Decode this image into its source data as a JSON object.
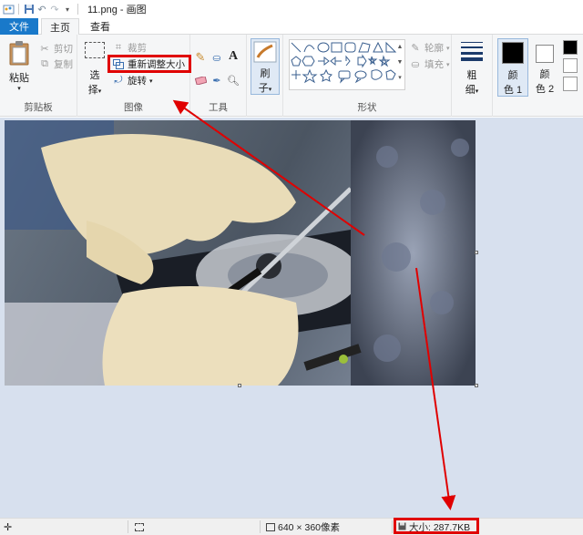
{
  "window": {
    "title": "11.png - 画图"
  },
  "tabs": {
    "file": "文件",
    "home": "主页",
    "view": "查看"
  },
  "clipboard": {
    "paste": "粘贴",
    "cut": "剪切",
    "copy": "复制",
    "group": "剪贴板"
  },
  "image": {
    "select_1": "选",
    "select_2": "择",
    "crop": "裁剪",
    "resize": "重新调整大小",
    "rotate": "旋转",
    "group": "图像"
  },
  "tools": {
    "group": "工具"
  },
  "brushes": {
    "label_1": "刷",
    "label_2": "子"
  },
  "shapes": {
    "outline": "轮廓",
    "fill": "填充",
    "group": "形状"
  },
  "size": {
    "label_1": "粗",
    "label_2": "细"
  },
  "colors": {
    "color1_1": "颜",
    "color1_2": "色 1",
    "color2_1": "颜",
    "color2_2": "色 2",
    "color1_value": "#000000",
    "color2_value": "#ffffff"
  },
  "status": {
    "dimensions": "640 × 360像素",
    "file_size": "大小: 287.7KB"
  },
  "accent": {
    "highlight": "#e00000",
    "file_tab": "#1979ca"
  }
}
